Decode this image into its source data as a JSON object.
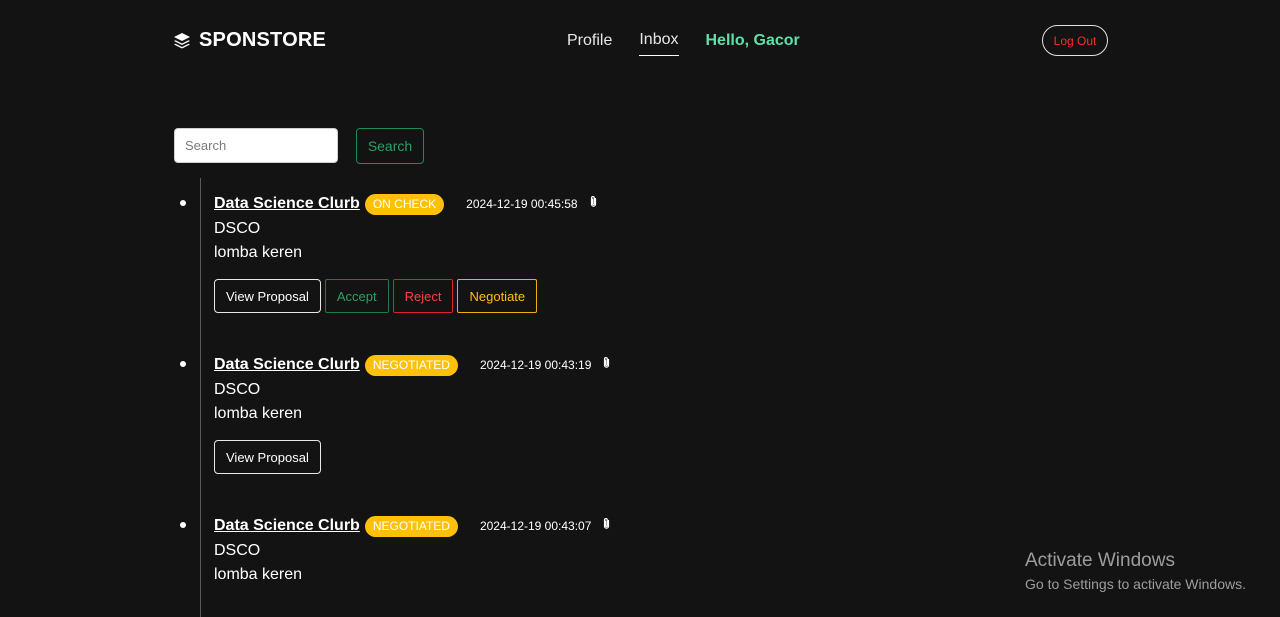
{
  "nav": {
    "brand": "SPONSTORE",
    "brand_icon": "layers-icon",
    "links": [
      "Profile",
      "Inbox"
    ],
    "active_link": "Inbox",
    "greeting": "Hello, Gacor",
    "logout_label": "Log Out"
  },
  "search": {
    "placeholder": "Search",
    "value": "",
    "button_label": "Search"
  },
  "messages": [
    {
      "title": "Data Science Clurb",
      "status": "ON CHECK",
      "timestamp": "2024-12-19 00:45:58",
      "attachment_icon": "paperclip-icon",
      "line1": "DSCO",
      "line2": "lomba keren",
      "actions": {
        "view": "View Proposal",
        "accept": "Accept",
        "reject": "Reject",
        "negotiate": "Negotiate"
      }
    },
    {
      "title": "Data Science Clurb",
      "status": "NEGOTIATED",
      "timestamp": "2024-12-19 00:43:19",
      "attachment_icon": "paperclip-icon",
      "line1": "DSCO",
      "line2": "lomba keren",
      "actions": {
        "view": "View Proposal"
      }
    },
    {
      "title": "Data Science Clurb",
      "status": "NEGOTIATED",
      "timestamp": "2024-12-19 00:43:07",
      "attachment_icon": "paperclip-icon",
      "line1": "DSCO",
      "line2": "lomba keren"
    }
  ],
  "watermark": {
    "title": "Activate Windows",
    "subtitle": "Go to Settings to activate Windows."
  },
  "colors": {
    "background": "#131313",
    "greeting": "#5fe0a8",
    "logout_text": "#ff2a2a",
    "accept": "#2e9e63",
    "reject": "#ff3f3f",
    "badge": "#ffc107"
  }
}
